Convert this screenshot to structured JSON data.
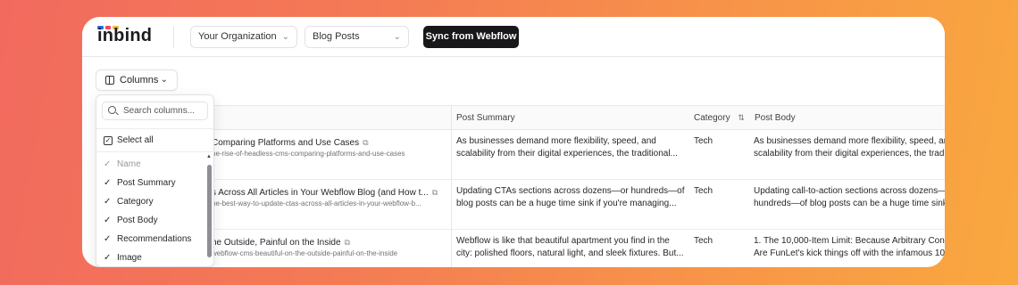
{
  "header": {
    "logo": "inbind",
    "logo_colors": [
      "#2f6fed",
      "#f24b5b",
      "#f6b93b"
    ],
    "org_select": "Your Organization",
    "collection_select": "Blog Posts",
    "sync_button": "Sync from Webflow"
  },
  "toolbar": {
    "columns_button": "Columns"
  },
  "table": {
    "headers": {
      "post_summary": "Post Summary",
      "category": "Category",
      "post_body": "Post Body"
    },
    "rows": [
      {
        "name": "Comparing Platforms and Use Cases",
        "slug": "he-rise-of-headless-cms-comparing-platforms-and-use-cases",
        "summary_1": "As businesses demand more flexibility, speed, and",
        "summary_2": "scalability from their digital experiences, the traditional...",
        "category": "Tech",
        "body_1": "As businesses demand more flexibility, speed, an",
        "body_2": "scalability from their digital experiences, the trad"
      },
      {
        "name": "s Across All Articles in Your Webflow Blog (and How t...",
        "slug": "he-best-way-to-update-ctas-across-all-articles-in-your-webflow-b...",
        "summary_1": "Updating CTAs sections across dozens—or hundreds—of",
        "summary_2": "blog posts can be a huge time sink if you're managing...",
        "category": "Tech",
        "body_1": "Updating call-to-action sections across dozens—",
        "body_2": "hundreds—of blog posts can be a huge time sink"
      },
      {
        "name": "he Outside, Painful on the Inside",
        "slug": "webflow-cms-beautiful-on-the-outside-painful-on-the-inside",
        "summary_1": "Webflow is like that beautiful apartment you find in the",
        "summary_2": "city: polished floors, natural light, and sleek fixtures. But...",
        "category": "Tech",
        "body_1": "1. The 10,000-Item Limit: Because Arbitrary Cons",
        "body_2": "Are FunLet's kick things off with the infamous 10"
      }
    ]
  },
  "dropdown": {
    "search_placeholder": "Search columns...",
    "select_all": "Select all",
    "items": [
      {
        "label": "Name",
        "checked": true,
        "disabled": true
      },
      {
        "label": "Post Summary",
        "checked": true,
        "disabled": false
      },
      {
        "label": "Category",
        "checked": true,
        "disabled": false
      },
      {
        "label": "Post Body",
        "checked": true,
        "disabled": false
      },
      {
        "label": "Recommendations",
        "checked": true,
        "disabled": false
      },
      {
        "label": "Image",
        "checked": true,
        "disabled": false
      }
    ]
  }
}
